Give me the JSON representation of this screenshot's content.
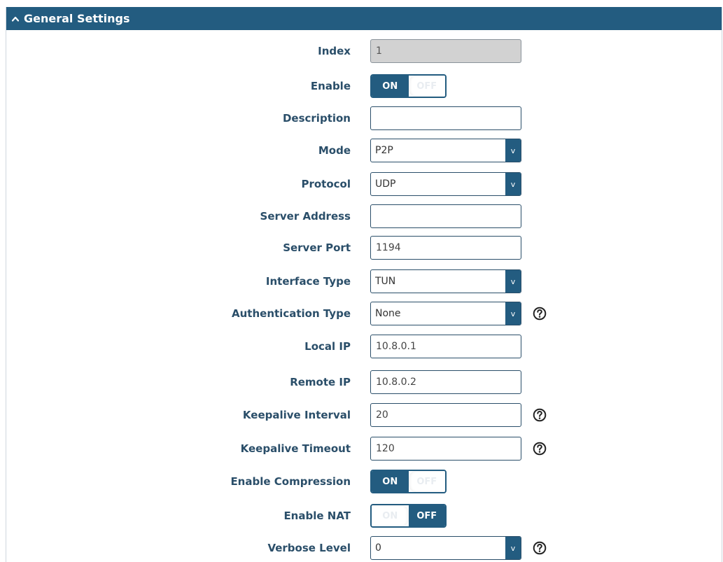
{
  "header": {
    "title": "General Settings"
  },
  "colors": {
    "header_bg": "#235c80",
    "label_text": "#2a4e69"
  },
  "fields": {
    "index": {
      "label": "Index",
      "value": "1"
    },
    "enable": {
      "label": "Enable",
      "on_label": "ON",
      "off_label": "OFF",
      "state": "on"
    },
    "description": {
      "label": "Description",
      "value": ""
    },
    "mode": {
      "label": "Mode",
      "value": "P2P"
    },
    "protocol": {
      "label": "Protocol",
      "value": "UDP"
    },
    "server_address": {
      "label": "Server Address",
      "value": ""
    },
    "server_port": {
      "label": "Server Port",
      "value": "1194"
    },
    "interface_type": {
      "label": "Interface Type",
      "value": "TUN"
    },
    "authentication_type": {
      "label": "Authentication Type",
      "value": "None"
    },
    "local_ip": {
      "label": "Local IP",
      "value": "10.8.0.1"
    },
    "remote_ip": {
      "label": "Remote IP",
      "value": "10.8.0.2"
    },
    "keepalive_interval": {
      "label": "Keepalive Interval",
      "value": "20"
    },
    "keepalive_timeout": {
      "label": "Keepalive Timeout",
      "value": "120"
    },
    "enable_compression": {
      "label": "Enable Compression",
      "on_label": "ON",
      "off_label": "OFF",
      "state": "on"
    },
    "enable_nat": {
      "label": "Enable NAT",
      "on_label": "ON",
      "off_label": "OFF",
      "state": "off"
    },
    "verbose_level": {
      "label": "Verbose Level",
      "value": "0"
    }
  },
  "icons": {
    "header_caret": "chevron-up-icon",
    "select_arrow": "v",
    "help": "help-icon"
  }
}
